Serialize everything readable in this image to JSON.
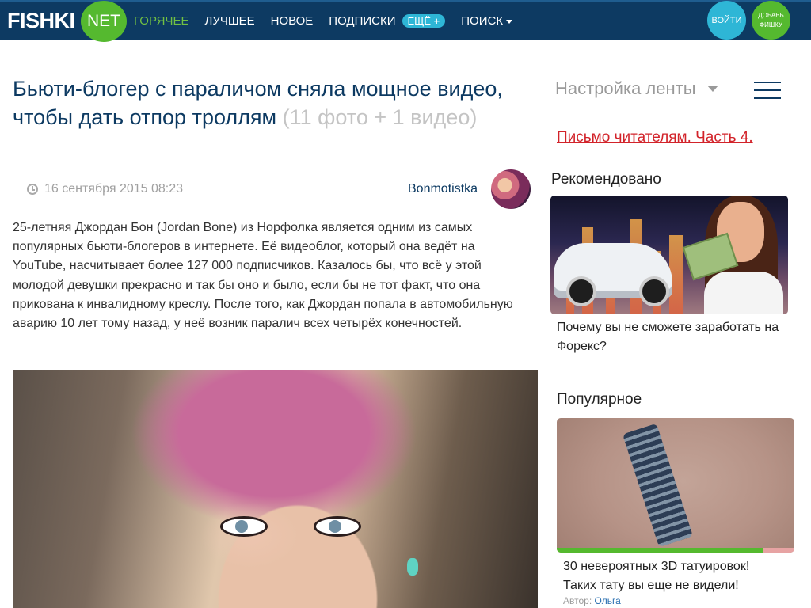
{
  "header": {
    "logo_text": "FISHKI",
    "logo_badge": "NET",
    "nav": [
      "ГОРЯЧЕЕ",
      "ЛУЧШЕЕ",
      "НОВОЕ",
      "ПОДПИСКИ"
    ],
    "more_label": "ЕЩЁ +",
    "search_label": "ПОИСК",
    "login_label": "ВОЙТИ",
    "add_label_line1": "ДОБАВЬ",
    "add_label_line2": "ФИШКУ",
    "colors": {
      "bar": "#0d3a62",
      "accent_green": "#55b92f",
      "accent_cyan": "#2eb6d6"
    }
  },
  "article": {
    "title": "Бьюти-блогер с параличом сняла мощное видео, чтобы дать отпор троллям",
    "media_count": "(11 фото + 1 видео)",
    "date": "16 сентября 2015 08:23",
    "author": "Bonmotistka",
    "body": "25-летняя Джордан Бон (Jordan Bone) из Норфолка является одним из самых популярных бьюти-блогеров в интернете. Её видеоблог, который она ведёт на YouTube, насчитывает более 127 000 подписчиков. Казалось бы, что всё у этой молодой девушки прекрасно и так бы оно и было, если бы не тот факт, что она прикована к инвалидному креслу. После того, как Джордан попала в автомобильную аварию 10 лет тому назад, у неё возник паралич всех четырёх конечностей."
  },
  "sidebar": {
    "feed_settings": "Настройка ленты",
    "reader_letter": "Письмо читателям. Часть 4.",
    "recommended_title": "Рекомендовано",
    "recommended_link": "Почему вы не сможете заработать на Форекс?",
    "popular_title": "Популярное",
    "popular_link": "30 невероятных 3D татуировок! Таких тату вы еще не видели!",
    "popular_author_label": "Автор:",
    "popular_author": "Ольга",
    "popular_rating_fraction": 0.87
  }
}
